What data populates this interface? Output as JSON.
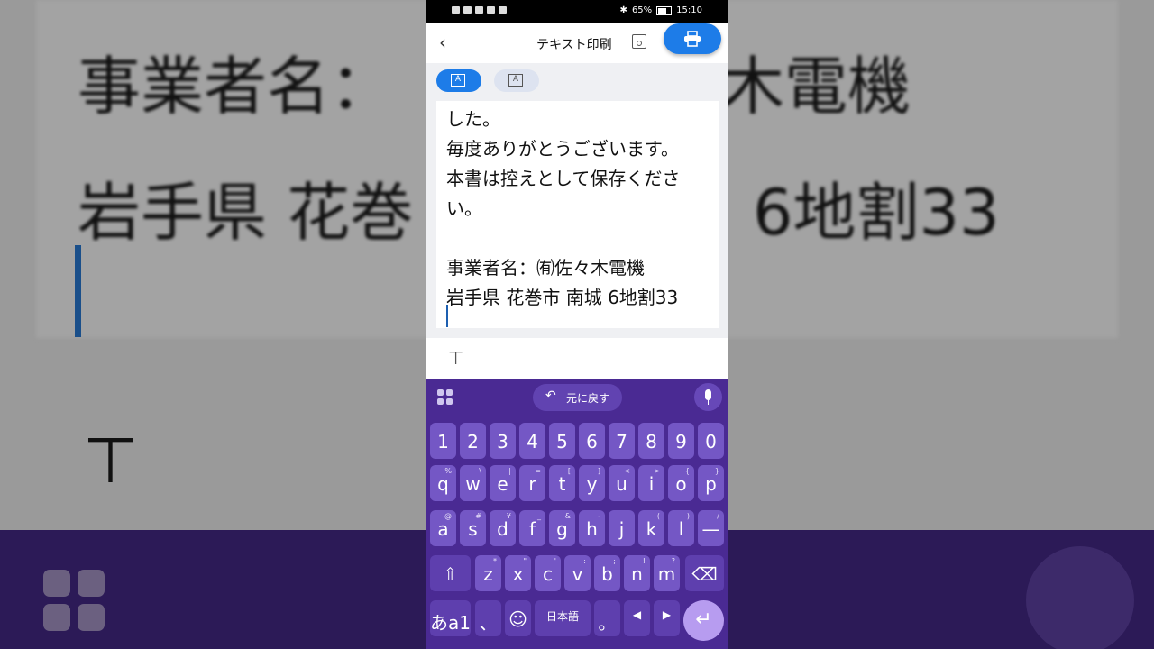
{
  "background": {
    "line1_left": "事業者名：",
    "line1_right": "木電機",
    "line2_left": "岩手県 花巻",
    "line2_right": "6地割33",
    "t_glyph": "⊤"
  },
  "status_bar": {
    "battery": "65%",
    "time": "15:10"
  },
  "app_bar": {
    "title": "テキスト印刷",
    "back_icon": "chevron-left-icon",
    "save_icon": "save-icon",
    "print_icon": "printer-icon",
    "accent_color": "#1d7ce8"
  },
  "editor": {
    "lines": [
      "した。",
      "毎度ありがとうございます。",
      "本書は控えとして保存くださ",
      "い。",
      "",
      "事業者名：㈲佐々木電機",
      "岩手県 花巻市 南城 6地割33"
    ]
  },
  "toolbar": {
    "t_icon": "⊤"
  },
  "keyboard": {
    "undo_label": "元に戻す",
    "number_row": [
      "1",
      "2",
      "3",
      "4",
      "5",
      "6",
      "7",
      "8",
      "9",
      "0"
    ],
    "row1": [
      {
        "k": "q",
        "s": "%"
      },
      {
        "k": "w",
        "s": "\\"
      },
      {
        "k": "e",
        "s": "|"
      },
      {
        "k": "r",
        "s": "="
      },
      {
        "k": "t",
        "s": "["
      },
      {
        "k": "y",
        "s": "]"
      },
      {
        "k": "u",
        "s": "<"
      },
      {
        "k": "i",
        "s": ">"
      },
      {
        "k": "o",
        "s": "{"
      },
      {
        "k": "p",
        "s": "}"
      }
    ],
    "row2": [
      {
        "k": "a",
        "s": "@"
      },
      {
        "k": "s",
        "s": "#"
      },
      {
        "k": "d",
        "s": "¥"
      },
      {
        "k": "f",
        "s": "_"
      },
      {
        "k": "g",
        "s": "&"
      },
      {
        "k": "h",
        "s": "-"
      },
      {
        "k": "j",
        "s": "+"
      },
      {
        "k": "k",
        "s": "("
      },
      {
        "k": "l",
        "s": ")"
      },
      {
        "k": "—",
        "s": "/"
      }
    ],
    "row3": [
      {
        "k": "z",
        "s": "*"
      },
      {
        "k": "x",
        "s": "\""
      },
      {
        "k": "c",
        "s": "'"
      },
      {
        "k": "v",
        "s": ":"
      },
      {
        "k": "b",
        "s": ";"
      },
      {
        "k": "n",
        "s": "!"
      },
      {
        "k": "m",
        "s": "?"
      }
    ],
    "shift_icon": "⇧",
    "backspace_icon": "⌫",
    "lang_switch": "あa1",
    "comma": "、",
    "emoji_icon": "☺",
    "mode_label": "日本語",
    "period": "。",
    "left_arrow": "◀",
    "right_arrow": "▶",
    "enter_icon": "↵",
    "keyboard_color": "#4a2a93"
  }
}
